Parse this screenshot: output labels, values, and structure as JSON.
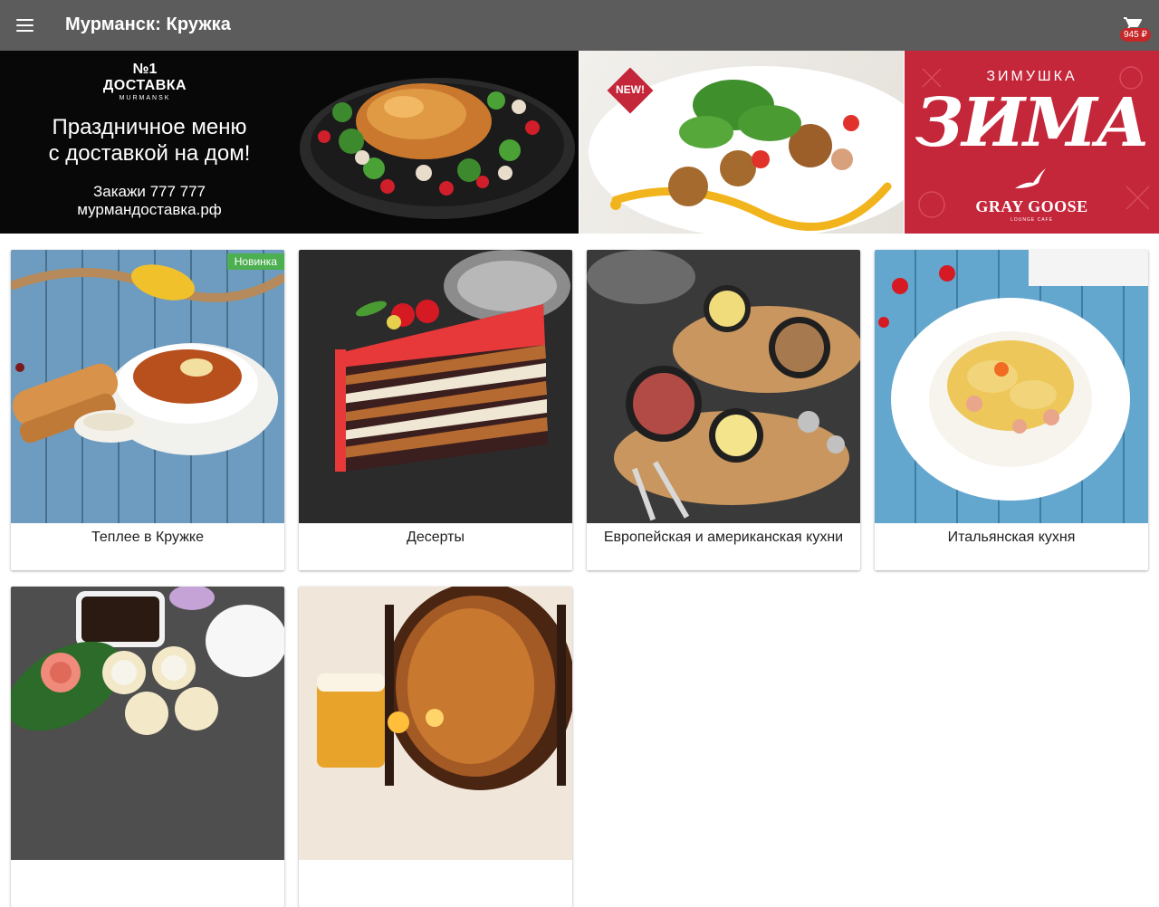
{
  "app_bar": {
    "title": "Мурманск: Кружка",
    "cart_total": "945 ₽"
  },
  "icons": {
    "menu": "hamburger-menu-icon",
    "cart": "shopping-cart-icon"
  },
  "banners": [
    {
      "logo_number": "№1",
      "logo_brand": "ДОСТАВКА",
      "logo_city": "MURMANSK",
      "headline_line1": "Праздничное меню",
      "headline_line2": "с доставкой на дом!",
      "phone": "Закажи 777 777",
      "site": "мурмандоставка.рф"
    },
    {
      "badge": "NEW!"
    },
    {
      "top_text": "ЗИМУШКА",
      "main_text": "ЗИМА",
      "brand": "GRAY GOOSE",
      "sub_text": "LOUNGE CAFE"
    }
  ],
  "categories": [
    {
      "label": "Теплее в Кружке",
      "badge": "Новинка"
    },
    {
      "label": "Десерты"
    },
    {
      "label": "Европейская и американская кухни"
    },
    {
      "label": "Итальянская кухня"
    },
    {
      "label": ""
    },
    {
      "label": ""
    }
  ],
  "colors": {
    "app_bar": "#5c5c5c",
    "cart_badge": "#c62828",
    "new_badge": "#4caf50",
    "banner_red": "#c4263a"
  }
}
